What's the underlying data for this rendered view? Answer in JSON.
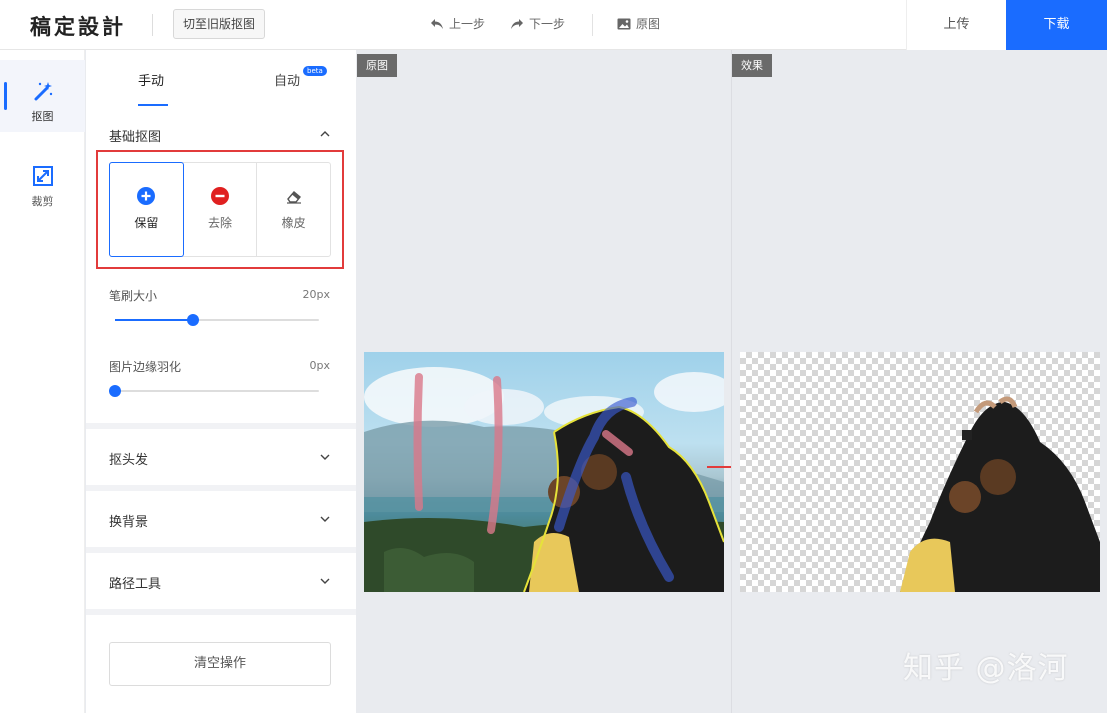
{
  "app": {
    "logo": "稿定設計",
    "old_version_label": "切至旧版抠图",
    "undo_label": "上一步",
    "redo_label": "下一步",
    "original_label": "原图",
    "upload_label": "上传",
    "download_label": "下载"
  },
  "rail": {
    "items": [
      {
        "label": "抠图",
        "icon": "magic-wand-icon",
        "active": true
      },
      {
        "label": "裁剪",
        "icon": "crop-icon",
        "active": false
      }
    ]
  },
  "panel": {
    "tabs": [
      {
        "label": "手动",
        "active": true
      },
      {
        "label": "自动",
        "badge": "beta",
        "active": false
      }
    ],
    "basic_section_title": "基础抠图",
    "tools": [
      {
        "label": "保留",
        "icon": "plus-circle-icon",
        "color": "#1a6cff",
        "active": true
      },
      {
        "label": "去除",
        "icon": "minus-circle-icon",
        "color": "#e02020",
        "active": false
      },
      {
        "label": "橡皮",
        "icon": "eraser-icon",
        "active": false
      }
    ],
    "brush_size": {
      "label": "笔刷大小",
      "value": "20px",
      "fraction": 0.38
    },
    "feather": {
      "label": "图片边缘羽化",
      "value": "0px",
      "fraction": 0.0
    },
    "accordions": [
      "抠头发",
      "换背景",
      "路径工具"
    ],
    "clear_label": "清空操作"
  },
  "canvas": {
    "original_tag": "原图",
    "result_tag": "效果"
  },
  "watermark": "知乎 @洛河",
  "colors": {
    "accent": "#1a6cff",
    "remove": "#e02020",
    "highlight": "#e23b3b"
  }
}
